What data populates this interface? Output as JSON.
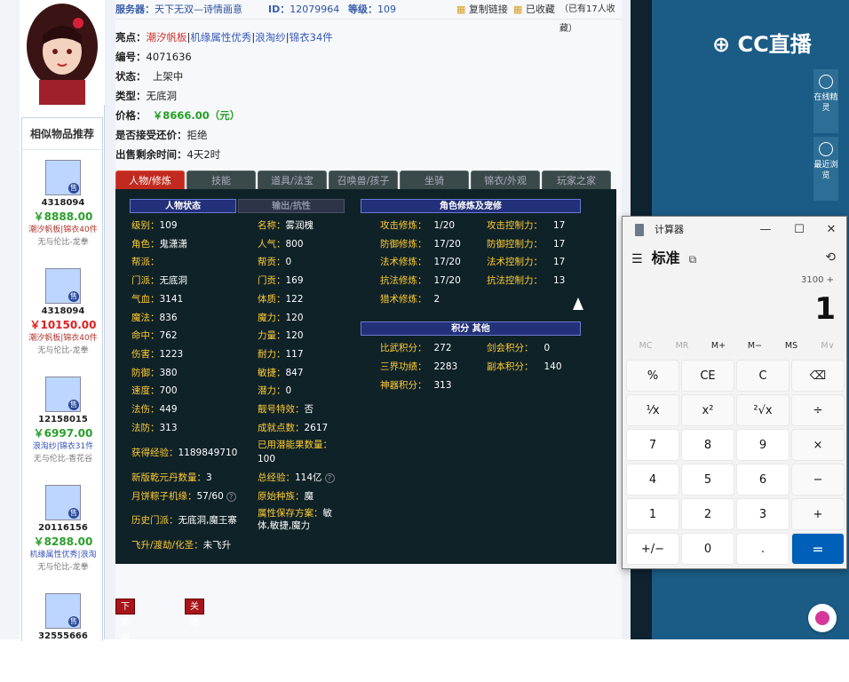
{
  "top_bar": {
    "server_label": "服务器：",
    "server_value": "天下无双—诗情画意",
    "id_label": "ID：",
    "id_value": "12079964",
    "level_label": "等级：",
    "level_value": "109",
    "copy_link": "复制链接",
    "favorited": "已收藏",
    "fav_count": "（已有17人收藏）"
  },
  "item": {
    "highlight_label": "亮点：",
    "highlights": [
      "潮汐帆板",
      "机缘属性优秀",
      "浪淘纱",
      "锦衣34件"
    ],
    "number_label": "编号：",
    "number_value": "4071636",
    "status_label": "状态：",
    "status_value": "上架中",
    "type_label": "类型：",
    "type_value": "无底洞",
    "price_label": "价格：",
    "price_value": "￥8666.00（元）",
    "counter_label": "是否接受还价：",
    "counter_value": "拒绝",
    "remaining_label": "出售剩余时间：",
    "remaining_value": "4天2时"
  },
  "tabs": [
    "人物/修炼",
    "技能",
    "道具/法宝",
    "召唤兽/孩子",
    "坐骑",
    "锦衣/外观",
    "玩家之家"
  ],
  "panel": {
    "headers": {
      "status": "人物状态",
      "output": "输出/抗性",
      "cultivation": "角色修炼及宠修",
      "points": "积分 其他"
    },
    "col1": [
      {
        "k": "级别：",
        "v": "109"
      },
      {
        "k": "角色：",
        "v": "鬼潇潇"
      },
      {
        "k": "帮派：",
        "v": ""
      },
      {
        "k": "门派：",
        "v": "无底洞"
      },
      {
        "k": "气血：",
        "v": "3141"
      },
      {
        "k": "魔法：",
        "v": "836"
      },
      {
        "k": "命中：",
        "v": "762"
      },
      {
        "k": "伤害：",
        "v": "1223"
      },
      {
        "k": "防御：",
        "v": "380"
      },
      {
        "k": "速度：",
        "v": "700"
      },
      {
        "k": "法伤：",
        "v": "449"
      },
      {
        "k": "法防：",
        "v": "313"
      }
    ],
    "col2": [
      {
        "k": "名称：",
        "v": "雾润槐"
      },
      {
        "k": "人气：",
        "v": "800"
      },
      {
        "k": "帮贡：",
        "v": "0"
      },
      {
        "k": "门贡：",
        "v": "169"
      },
      {
        "k": "体质：",
        "v": "122"
      },
      {
        "k": "魔力：",
        "v": "120"
      },
      {
        "k": "力量：",
        "v": "120"
      },
      {
        "k": "耐力：",
        "v": "117"
      },
      {
        "k": "敏捷：",
        "v": "847"
      },
      {
        "k": "潜力：",
        "v": "0"
      },
      {
        "k": "靓号特效：",
        "v": "否"
      },
      {
        "k": "成就点数：",
        "v": "2617"
      }
    ],
    "extra": {
      "exp_k": "获得经验：",
      "exp_v": "1189849710",
      "used_k": "已用潜能果数量：",
      "used_v": "100",
      "yuan_k": "新版乾元丹数量：",
      "yuan_v": "3",
      "total_k": "总经验：",
      "total_v": "114亿",
      "moon_k": "月饼粽子机缘：",
      "moon_v": "57/60",
      "race_k": "原始种族：",
      "race_v": "魔",
      "hist_k": "历史门派：",
      "hist_v": "无底洞,魔王寨",
      "save_k": "属性保存方案：",
      "save_v": "敏体,敏捷,魔力",
      "fly_k": "飞升/渡劫/化圣：",
      "fly_v": "未飞升"
    },
    "cultivation": [
      {
        "k": "攻击修炼：",
        "v": "1/20",
        "k2": "攻击控制力：",
        "v2": "17"
      },
      {
        "k": "防御修炼：",
        "v": "17/20",
        "k2": "防御控制力：",
        "v2": "17"
      },
      {
        "k": "法术修炼：",
        "v": "17/20",
        "k2": "法术控制力：",
        "v2": "17"
      },
      {
        "k": "抗法修炼：",
        "v": "17/20",
        "k2": "抗法控制力：",
        "v2": "13"
      },
      {
        "k": "猎术修炼：",
        "v": "2",
        "k2": "",
        "v2": ""
      }
    ],
    "points": [
      {
        "k": "比武积分：",
        "v": "272",
        "k2": "剑会积分：",
        "v2": "0"
      },
      {
        "k": "三界功绩：",
        "v": "2283",
        "k2": "副本积分：",
        "v2": "140"
      },
      {
        "k": "神器积分：",
        "v": "313",
        "k2": "",
        "v2": ""
      }
    ]
  },
  "buttons": {
    "buy": "下单购买",
    "close": "关闭"
  },
  "similar": {
    "title": "相似物品推荐",
    "items": [
      {
        "id": "4318094",
        "price": "￥8888.00",
        "red": false,
        "tags": "潮汐帆板|锦衣40件",
        "tags_blue": false,
        "server": "无与伦比-龙拳"
      },
      {
        "id": "4318094",
        "price": "￥10150.00",
        "red": true,
        "tags": "潮汐帆板|锦衣40件",
        "tags_blue": false,
        "server": "无与伦比-龙拳"
      },
      {
        "id": "12158015",
        "price": "￥6997.00",
        "red": false,
        "tags": "浪淘纱|锦衣31件",
        "tags_blue": true,
        "server": "无与伦比-香花谷"
      },
      {
        "id": "20116156",
        "price": "￥8288.00",
        "red": false,
        "tags": "机缘属性优秀|浪淘",
        "tags_blue": true,
        "server": "无与伦比-龙拳"
      },
      {
        "id": "32555666",
        "price": "",
        "red": false,
        "tags": "",
        "tags_blue": false,
        "server": ""
      }
    ],
    "sell_badge": "售"
  },
  "right": {
    "brand": "CC直播",
    "tools": [
      {
        "label": "在线精灵"
      },
      {
        "label": "最近浏览"
      }
    ]
  },
  "calculator": {
    "title": "计算器",
    "mode": "标准",
    "expression": "3100 +",
    "display": "1",
    "memory": [
      "MC",
      "MR",
      "M+",
      "M−",
      "MS",
      "M∨"
    ],
    "keys": [
      "%",
      "CE",
      "C",
      "⌫",
      "¹⁄x",
      "x²",
      "²√x",
      "÷",
      "7",
      "8",
      "9",
      "×",
      "4",
      "5",
      "6",
      "−",
      "1",
      "2",
      "3",
      "+",
      "+/−",
      "0",
      ".",
      "="
    ]
  },
  "colors": {
    "accent_red": "#c22a1f",
    "price_green": "#22a022",
    "panel_bg": "#0f2228",
    "calc_eq": "#005fb8"
  }
}
